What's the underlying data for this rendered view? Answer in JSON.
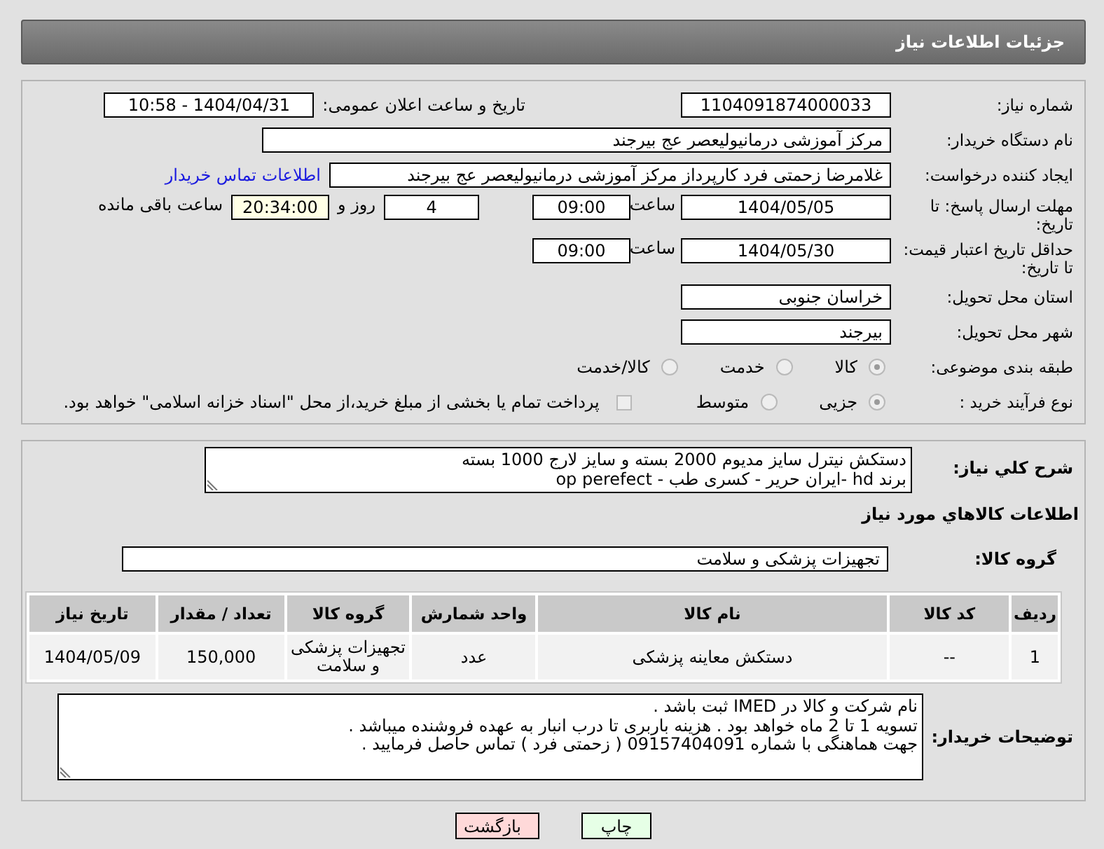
{
  "header": {
    "title": "جزئیات اطلاعات نیاز"
  },
  "need_number": {
    "label": "شماره نیاز:",
    "value": "1104091874000033"
  },
  "announce": {
    "label": "تاریخ و ساعت اعلان عمومی:",
    "value": "1404/04/31 - 10:58"
  },
  "buyer_org": {
    "label": "نام دستگاه خریدار:",
    "value": "مرکز آموزشی درمانیولیعصر  عج  بیرجند"
  },
  "requester": {
    "label": "ایجاد کننده درخواست:",
    "value": "غلامرضا زحمتی فرد کارپرداز مرکز آموزشی درمانیولیعصر  عج  بیرجند",
    "link": "اطلاعات تماس خریدار"
  },
  "reply_deadline": {
    "label": "مهلت ارسال پاسخ: تا تاریخ:",
    "date": "1404/05/05",
    "time_label": "ساعت",
    "time": "09:00",
    "days": "4",
    "days_label": "روز و",
    "remaining": "20:34:00",
    "remaining_label": "ساعت باقی مانده"
  },
  "price_validity": {
    "label": "حداقل تاریخ اعتبار قیمت: تا تاریخ:",
    "date": "1404/05/30",
    "time_label": "ساعت",
    "time": "09:00"
  },
  "province": {
    "label": "استان محل تحویل:",
    "value": "خراسان جنوبی"
  },
  "city": {
    "label": "شهر محل تحویل:",
    "value": "بیرجند"
  },
  "category": {
    "label": "طبقه بندی موضوعی:",
    "options": [
      {
        "label": "کالا",
        "selected": true
      },
      {
        "label": "خدمت",
        "selected": false
      },
      {
        "label": "کالا/خدمت",
        "selected": false
      }
    ]
  },
  "process": {
    "label": "نوع فرآیند خرید :",
    "options": [
      {
        "label": "جزیی",
        "selected": true
      },
      {
        "label": "متوسط",
        "selected": false
      }
    ],
    "payment": {
      "checked": false,
      "text": "پرداخت تمام یا بخشی از مبلغ خرید،از محل \"اسناد خزانه اسلامی\" خواهد بود."
    }
  },
  "description": {
    "label": "شرح کلي نیاز:",
    "lines": [
      "دستکش نیترل سایز مدیوم 2000 بسته و سایز لارج 1000 بسته",
      "برند hd -ایران حریر - کسری طب - op perefect"
    ]
  },
  "goods_title": "اطلاعات کالاهاي مورد نیاز",
  "goods_group": {
    "label": "گروه کالا:",
    "value": "تجهیزات پزشکی و سلامت"
  },
  "table": {
    "columns": [
      "ردیف",
      "کد کالا",
      "نام کالا",
      "واحد شمارش",
      "گروه کالا",
      "تعداد / مقدار",
      "تاریخ نیاز"
    ],
    "rows": [
      [
        "1",
        "--",
        "دستکش معاینه پزشکی",
        "عدد",
        "تجهیزات پزشکی و سلامت",
        "150,000",
        "1404/05/09"
      ]
    ]
  },
  "buyer_notes": {
    "label": "توضیحات خریدار:",
    "lines": [
      "نام شرکت و کالا در IMED ثبت باشد .",
      "تسویه 1 تا 2 ماه خواهد بود . هزینه باربری تا درب انبار به عهده فروشنده میباشد .",
      "جهت هماهنگی با شماره 09157404091 ( زحمتی فرد ) تماس حاصل فرمایید ."
    ]
  },
  "buttons": [
    {
      "kind": "print",
      "label": "چاپ"
    },
    {
      "kind": "back",
      "label": "بازگشت"
    }
  ]
}
